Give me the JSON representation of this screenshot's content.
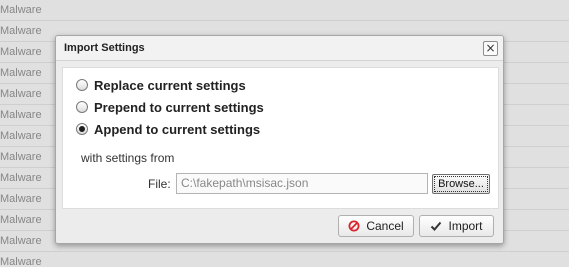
{
  "background": {
    "rows": [
      "Malware",
      "Malware",
      "Malware",
      "Malware",
      "Malware",
      "Malware",
      "Malware",
      "Malware",
      "Malware",
      "Malware",
      "Malware",
      "Malware",
      "Malware"
    ]
  },
  "dialog": {
    "title": "Import Settings",
    "close_symbol": "×",
    "options": [
      {
        "label": "Replace current settings",
        "checked": false
      },
      {
        "label": "Prepend to current settings",
        "checked": false
      },
      {
        "label": "Append to current settings",
        "checked": true
      }
    ],
    "subheading": "with settings from",
    "file_label": "File:",
    "file_value": "C:\\fakepath\\msisac.json",
    "browse_label": "Browse...",
    "cancel_label": "Cancel",
    "import_label": "Import",
    "icons": {
      "cancel": "cancel-circle-icon",
      "import": "checkmark-icon",
      "close": "close-icon"
    },
    "colors": {
      "cancel_icon": "#d9262c",
      "import_icon": "#333333"
    }
  }
}
